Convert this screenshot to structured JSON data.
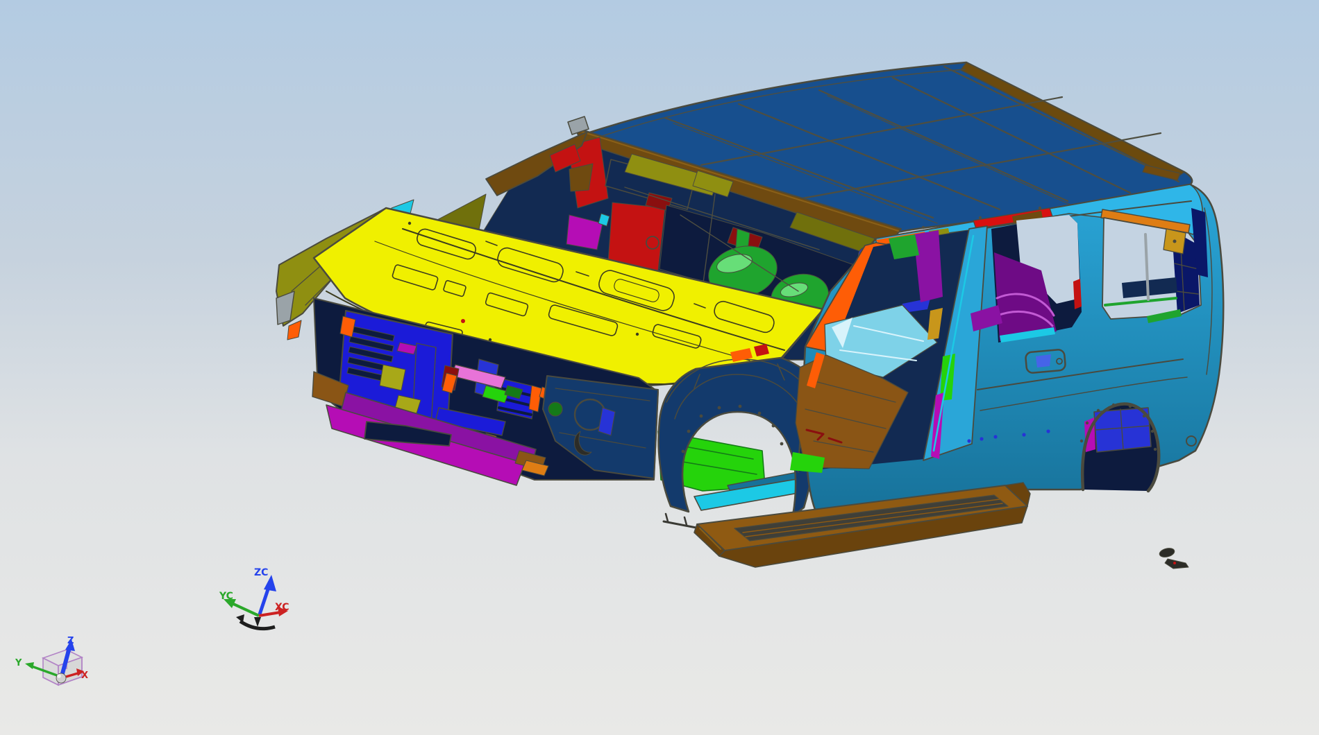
{
  "viewport": {
    "type": "cad-3d-viewport",
    "wcs_triad": {
      "z_label": "ZC",
      "y_label": "YC",
      "x_label": "XC"
    },
    "abs_triad": {
      "z_label": "Z",
      "y_label": "Y",
      "x_label": "X"
    }
  },
  "model": {
    "name": "suv-body-in-white",
    "palette": {
      "bg_top": "#b3cbe2",
      "bg_mid": "#c6d2de",
      "bg_low": "#dfe2e4",
      "bg_bottom": "#e9e9e7",
      "sky": "#c4d3e2",
      "outline": "#4a4a3e",
      "roof": "#174f8e",
      "roof_seam": "#4e4e40",
      "roof_edge": "#6b4a0e",
      "header_brown": "#6f4a10",
      "header_hi": "#8a6018",
      "rail_cyan": "#2fb6e8",
      "sill_cyan": "#1cc9e5",
      "floor_cyan": "#7ed2e8",
      "floor_hi": "#d8f3fb",
      "body_hi": "#2aa6d8",
      "body_lo": "#177199",
      "pillar_orange": "#fe5d06",
      "amber": "#de7d14",
      "bow_red": "#d81010",
      "red": "#c41212",
      "dark_red": "#8a0f0f",
      "hood": "#f0f000",
      "hood_line": "#3c3c1e",
      "olive": "#8f8f11",
      "olive_dark": "#70700c",
      "olive_plate": "#a8a818",
      "fender_navy": "#133a6c",
      "navy_int": "#122a52",
      "navy_deep": "#0d1b3e",
      "inner_navy": "#0a1768",
      "royal": "#2733d6",
      "bright_blue": "#1b1bd8",
      "green_bright": "#25d30b",
      "green_mid": "#1fa42e",
      "green_hi": "#67de78",
      "green_dark": "#157a18",
      "floor_brown": "#8a5515",
      "board_top": "#8f5a12",
      "board_side": "#6a430d",
      "tread": "#3f3f38",
      "gold": "#c8961b",
      "purple": "#8a12a3",
      "purple_deep": "#6e0b85",
      "violet_hi": "#c25ad4",
      "magenta": "#b50db5",
      "pink": "#e873d8",
      "glint_blue": "#4664e8",
      "gray_part": "#9aa3a8",
      "debris": "#2c2c27",
      "bracket_gray": "#3a3a34",
      "axis_x": "#cc2222",
      "axis_y": "#2aa82a",
      "axis_z": "#2543ec",
      "cube_purple": "#b284c6",
      "sphere": "#cfcfcf",
      "sphere_hi": "#f0f0f0",
      "wcs_black": "#1e1e1e"
    },
    "parts": [
      {
        "name": "roof-panel",
        "color": "roof"
      },
      {
        "name": "windshield-header-rail",
        "color": "header_brown"
      },
      {
        "name": "hood-panel",
        "color": "hood"
      },
      {
        "name": "left-fender-apron",
        "color": "olive"
      },
      {
        "name": "left-a-pillar",
        "color": "header_brown"
      },
      {
        "name": "sun-visor-bracket",
        "color": "red"
      },
      {
        "name": "cowl-top-panel",
        "color": "magenta"
      },
      {
        "name": "dash-firewall",
        "color": "navy_int"
      },
      {
        "name": "engine-cover",
        "color": "green_mid"
      },
      {
        "name": "radiator-support",
        "color": "bright_blue"
      },
      {
        "name": "bumper-beam",
        "color": "purple"
      },
      {
        "name": "front-lower-bar",
        "color": "magenta"
      },
      {
        "name": "front-fender",
        "color": "fender_navy"
      },
      {
        "name": "front-wheel-apron",
        "color": "fender_navy"
      },
      {
        "name": "front-floor-pan",
        "color": "green_bright"
      },
      {
        "name": "rocker-sill",
        "color": "sill_cyan"
      },
      {
        "name": "floor-pan-center",
        "color": "floor_brown"
      },
      {
        "name": "front-floor-panel",
        "color": "floor_cyan"
      },
      {
        "name": "right-a-pillar",
        "color": "pillar_orange"
      },
      {
        "name": "roof-side-rail",
        "color": "rail_cyan"
      },
      {
        "name": "roof-bow",
        "color": "bow_red"
      },
      {
        "name": "b-pillar",
        "color": "body_hi"
      },
      {
        "name": "b-pillar-reinforcement",
        "color": "gold"
      },
      {
        "name": "body-side-outer",
        "color": "body_hi"
      },
      {
        "name": "rear-quarter-panel",
        "color": "body_hi"
      },
      {
        "name": "quarter-trim-panel",
        "color": "purple_deep"
      },
      {
        "name": "quarter-window-bracket",
        "color": "amber"
      },
      {
        "name": "d-pillar-inner",
        "color": "inner_navy"
      },
      {
        "name": "rear-wheelhouse",
        "color": "royal"
      },
      {
        "name": "running-board",
        "color": "board_top"
      },
      {
        "name": "running-board-tread",
        "color": "tread"
      },
      {
        "name": "loose-bracket-parts",
        "color": "debris"
      }
    ]
  }
}
